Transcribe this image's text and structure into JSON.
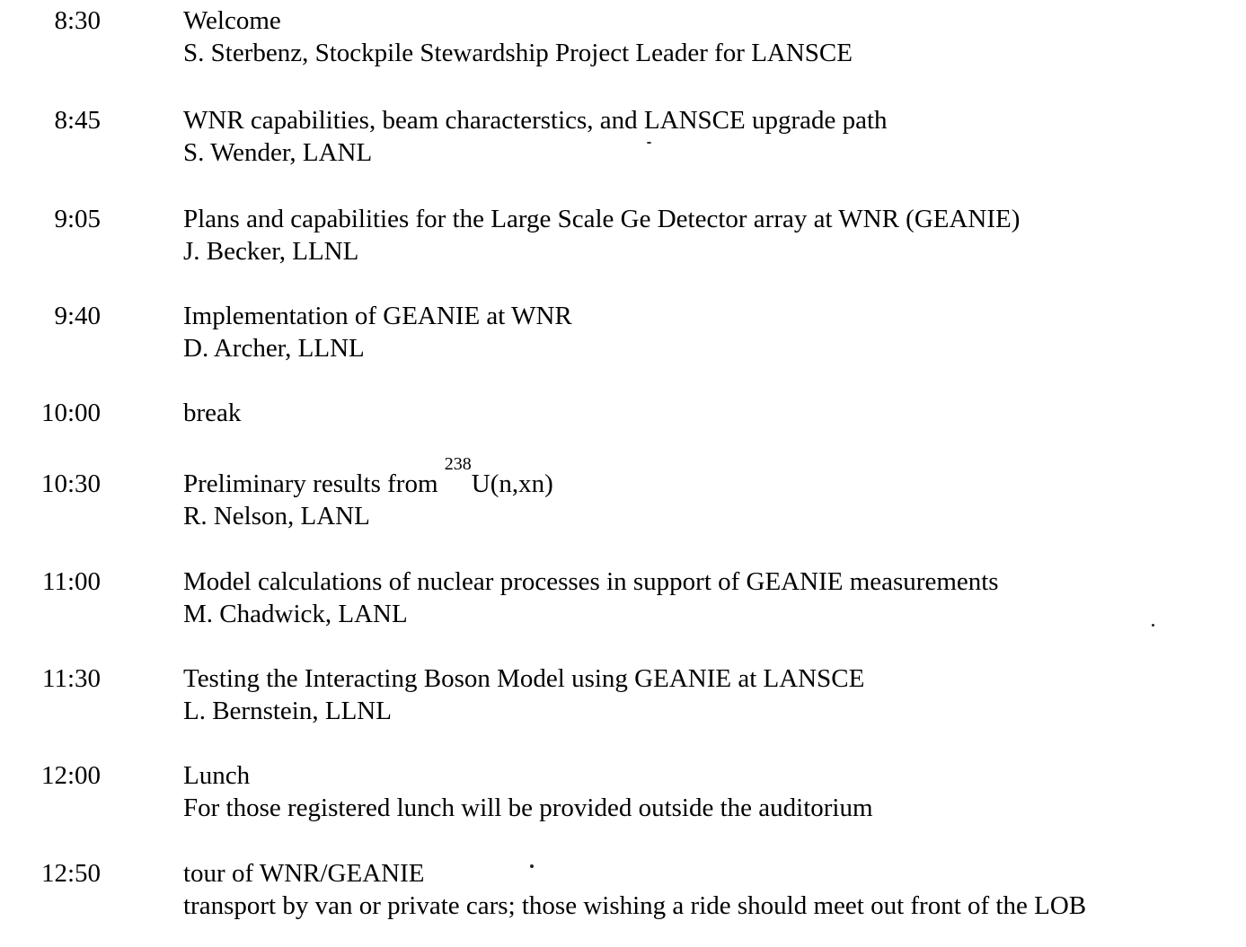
{
  "agenda": [
    {
      "time": "8:30",
      "title": "Welcome",
      "detail": "S. Sterbenz, Stockpile Stewardship Project Leader for LANSCE"
    },
    {
      "time": "8:45",
      "title": "WNR capabilities, beam characterstics, and LANSCE upgrade path",
      "detail": "S. Wender, LANL"
    },
    {
      "time": "9:05",
      "title": "Plans and capabilities for the Large Scale Ge Detector array at WNR (GEANIE)",
      "detail": "J. Becker, LLNL"
    },
    {
      "time": "9:40",
      "title": "Implementation of GEANIE at WNR",
      "detail": "D. Archer, LLNL"
    },
    {
      "time": "10:00",
      "title": "break"
    },
    {
      "time": "10:30",
      "title_prefix": "Preliminary results from ",
      "title_sup": "238",
      "title_suffix": "U(n,xn)",
      "detail": "R. Nelson, LANL"
    },
    {
      "time": "11:00",
      "title": "Model calculations of nuclear processes in support of GEANIE measurements",
      "detail": "M. Chadwick, LANL"
    },
    {
      "time": "11:30",
      "title": "Testing the Interacting Boson Model using GEANIE at LANSCE",
      "detail": "L. Bernstein, LLNL"
    },
    {
      "time": "12:00",
      "title": "Lunch",
      "detail": "For those registered lunch will be provided outside the auditorium"
    },
    {
      "time": "12:50",
      "title": "tour of WNR/GEANIE",
      "detail": "transport by van or private cars; those wishing a ride should meet out front of the LOB"
    }
  ]
}
